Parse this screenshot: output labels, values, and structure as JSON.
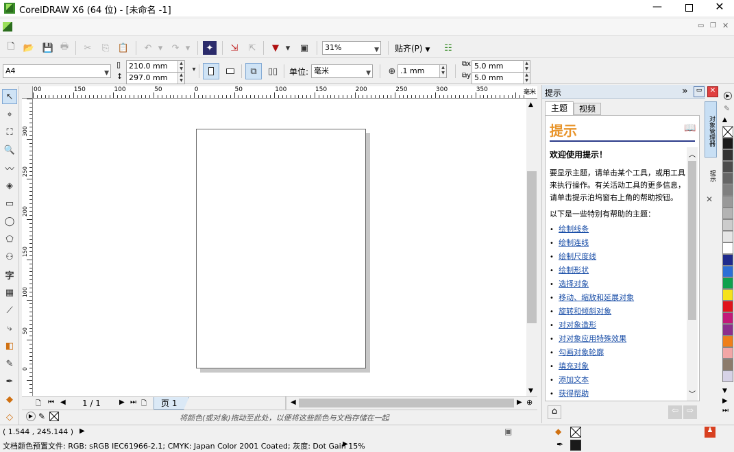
{
  "window": {
    "title": "CorelDRAW X6 (64 位) - [未命名 -1]"
  },
  "toolbar": {
    "zoom": "31%",
    "snap_label": "贴齐(P)"
  },
  "propbar": {
    "page_size": "A4",
    "width": "210.0 mm",
    "height": "297.0 mm",
    "units_label": "单位:",
    "units_value": "毫米",
    "nudge": ".1 mm",
    "dup_x": "5.0 mm",
    "dup_y": "5.0 mm"
  },
  "hruler": {
    "ticks": [
      "00",
      "150",
      "100",
      "50",
      "0",
      "50",
      "100",
      "150",
      "200",
      "250",
      "300",
      "350"
    ],
    "unit": "毫米"
  },
  "vruler": {
    "ticks": [
      "300",
      "250",
      "200",
      "150",
      "100",
      "50",
      "0"
    ]
  },
  "pagebar": {
    "page_count": "1 / 1",
    "page_tab": "页 1"
  },
  "palettebar": {
    "hint": "将颜色(或对象)拖动至此处，以便将这些颜色与文档存储在一起"
  },
  "docker": {
    "title": "提示",
    "tabs": [
      "主题",
      "视频"
    ],
    "heading": "提示",
    "welcome": "欢迎使用提示！",
    "intro": "要显示主题，请单击某个工具，或用工具来执行操作。有关活动工具的更多信息，请单击提示泊坞窗右上角的帮助按钮。",
    "list_title": "以下是一些特别有帮助的主题：",
    "links": [
      "绘制线条",
      "绘制连线",
      "绘制尺度线",
      "绘制形状",
      "选择对象",
      "移动、缩放和延展对象",
      "旋转和倾斜对象",
      "对对象造形",
      "对对象应用特殊效果",
      "勾画对象轮廓",
      "填充对象",
      "添加文本",
      "获得帮助"
    ]
  },
  "sidetabs": {
    "object_manager": "对象管理器",
    "hints": "提示"
  },
  "palette_colors": [
    "#ffffff",
    "#1a1a1a",
    "#333333",
    "#4d4d4d",
    "#666666",
    "#808080",
    "#999999",
    "#b3b3b3",
    "#cccccc",
    "#e6e6e6",
    "#ffffff",
    "#1e2a8c",
    "#2b6fd6",
    "#0fa14d",
    "#f5e21c",
    "#e0141c",
    "#c2197a",
    "#8c2f8e",
    "#ef7f1a",
    "#f2a6a6",
    "#8c7b6b",
    "#d6d2e6"
  ],
  "status": {
    "coords": "( 1.544 , 245.144 )",
    "profile": "文档颜色预置文件: RGB: sRGB IEC61966-2.1; CMYK: Japan Color 2001 Coated; 灰度: Dot Gain 15%"
  }
}
